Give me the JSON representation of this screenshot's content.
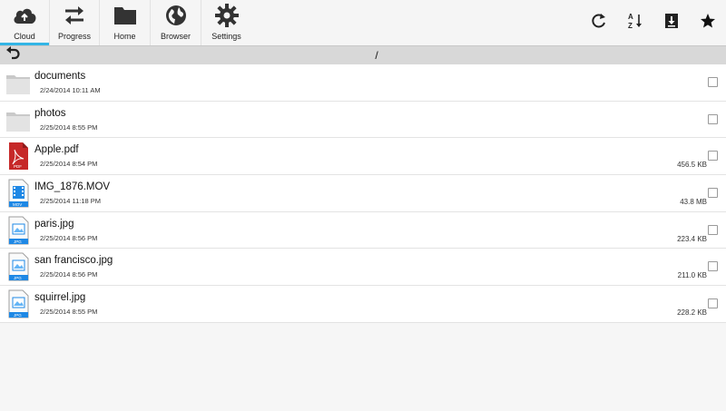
{
  "tabs": [
    {
      "label": "Cloud",
      "icon": "cloud-icon",
      "active": true
    },
    {
      "label": "Progress",
      "icon": "transfer-arrows-icon",
      "active": false
    },
    {
      "label": "Home",
      "icon": "folder-icon",
      "active": false
    },
    {
      "label": "Browser",
      "icon": "globe-icon",
      "active": false
    },
    {
      "label": "Settings",
      "icon": "gear-icon",
      "active": false
    }
  ],
  "actions": [
    {
      "icon": "refresh-icon"
    },
    {
      "icon": "sort-az-icon"
    },
    {
      "icon": "download-icon"
    },
    {
      "icon": "star-icon"
    }
  ],
  "path": "/",
  "files": [
    {
      "name": "documents",
      "date": "2/24/2014 10:11 AM",
      "size": "",
      "type": "folder"
    },
    {
      "name": "photos",
      "date": "2/25/2014 8:55 PM",
      "size": "",
      "type": "folder"
    },
    {
      "name": "Apple.pdf",
      "date": "2/25/2014 8:54 PM",
      "size": "456.5 KB",
      "type": "pdf"
    },
    {
      "name": "IMG_1876.MOV",
      "date": "2/25/2014 11:18 PM",
      "size": "43.8 MB",
      "type": "mov"
    },
    {
      "name": "paris.jpg",
      "date": "2/25/2014 8:56 PM",
      "size": "223.4 KB",
      "type": "jpg"
    },
    {
      "name": "san francisco.jpg",
      "date": "2/25/2014 8:56 PM",
      "size": "211.0 KB",
      "type": "jpg"
    },
    {
      "name": "squirrel.jpg",
      "date": "2/25/2014 8:55 PM",
      "size": "228.2 KB",
      "type": "jpg"
    }
  ],
  "file_type_badges": {
    "pdf": "PDF",
    "mov": "MOV",
    "jpg": "JPG"
  },
  "colors": {
    "accent": "#33b5e5",
    "icon_dark": "#333333",
    "pdf_red": "#c62828",
    "media_blue": "#1e88e5"
  }
}
